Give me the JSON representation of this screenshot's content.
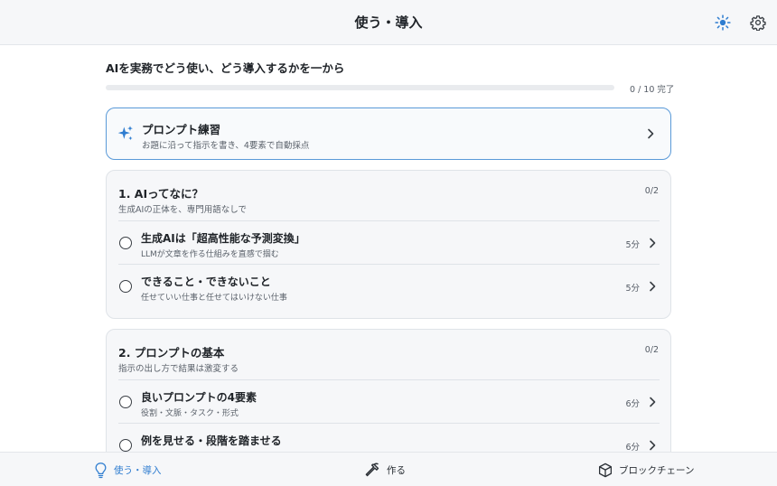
{
  "header": {
    "title": "使う・導入"
  },
  "intro": {
    "heading": "AIを実務でどう使い、どう導入するかを一から"
  },
  "progress": {
    "completed": 0,
    "total": 10,
    "text": "0 / 10 完了"
  },
  "practice": {
    "title": "プロンプト練習",
    "description": "お題に沿って指示を書き、4要素で自動採点"
  },
  "sections": [
    {
      "title": "1. AIってなに？",
      "count": "0/2",
      "description": "生成AIの正体を、専門用語なしで",
      "lessons": [
        {
          "title": "生成AIは「超高性能な予測変換」",
          "description": "LLMが文章を作る仕組みを直感で掴む",
          "time": "5分"
        },
        {
          "title": "できること・できないこと",
          "description": "任せていい仕事と任せてはいけない仕事",
          "time": "5分"
        }
      ]
    },
    {
      "title": "2. プロンプトの基本",
      "count": "0/2",
      "description": "指示の出し方で結果は激変する",
      "lessons": [
        {
          "title": "良いプロンプトの4要素",
          "description": "役割・文脈・タスク・形式",
          "time": "6分"
        },
        {
          "title": "例を見せる・段階を踏ませる",
          "description": "",
          "time": "6分"
        }
      ]
    }
  ],
  "nav": {
    "items": [
      {
        "label": "使う・導入",
        "icon": "lightbulb-icon",
        "active": true
      },
      {
        "label": "作る",
        "icon": "hammer-icon",
        "active": false
      },
      {
        "label": "ブロックチェーン",
        "icon": "cube-icon",
        "active": false
      }
    ]
  },
  "colors": {
    "accent": "#2f7dd0",
    "border": "#dfe3e8",
    "card_bg": "#f6f7f9"
  }
}
